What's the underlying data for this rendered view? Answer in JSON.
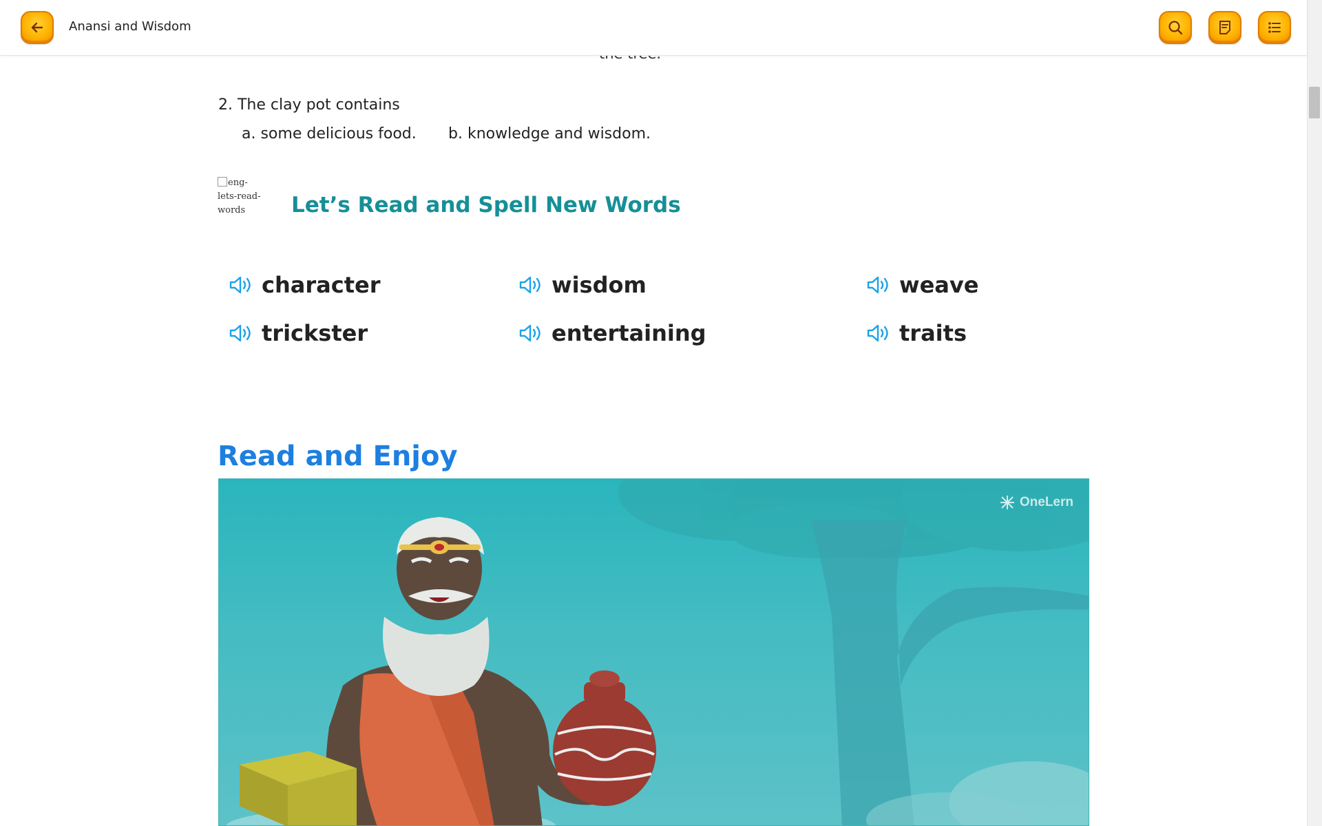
{
  "header": {
    "title": "Anansi and Wisdom",
    "back_icon": "arrow-left-icon",
    "search_icon": "search-icon",
    "notes_icon": "notes-icon",
    "toc_icon": "list-icon",
    "accent_color": "#ffb300"
  },
  "content": {
    "partial_line": "the tree.",
    "question": {
      "text": "2. The clay pot contains",
      "option_a": "a. some delicious food.",
      "option_b": "b. knowledge and wisdom."
    },
    "broken_image_alt": "eng-lets-read-words",
    "words_section": {
      "heading": "Let’s Read and Spell New Words",
      "heading_color": "#168f97",
      "words": [
        "character",
        "wisdom",
        "weave",
        "trickster",
        "entertaining",
        "traits"
      ],
      "speaker_icon": "speaker-icon",
      "speaker_color": "#1aa3e8"
    },
    "read_section": {
      "heading": "Read and Enjoy",
      "heading_color": "#1d7fe0",
      "video_watermark": "OneLern"
    }
  }
}
